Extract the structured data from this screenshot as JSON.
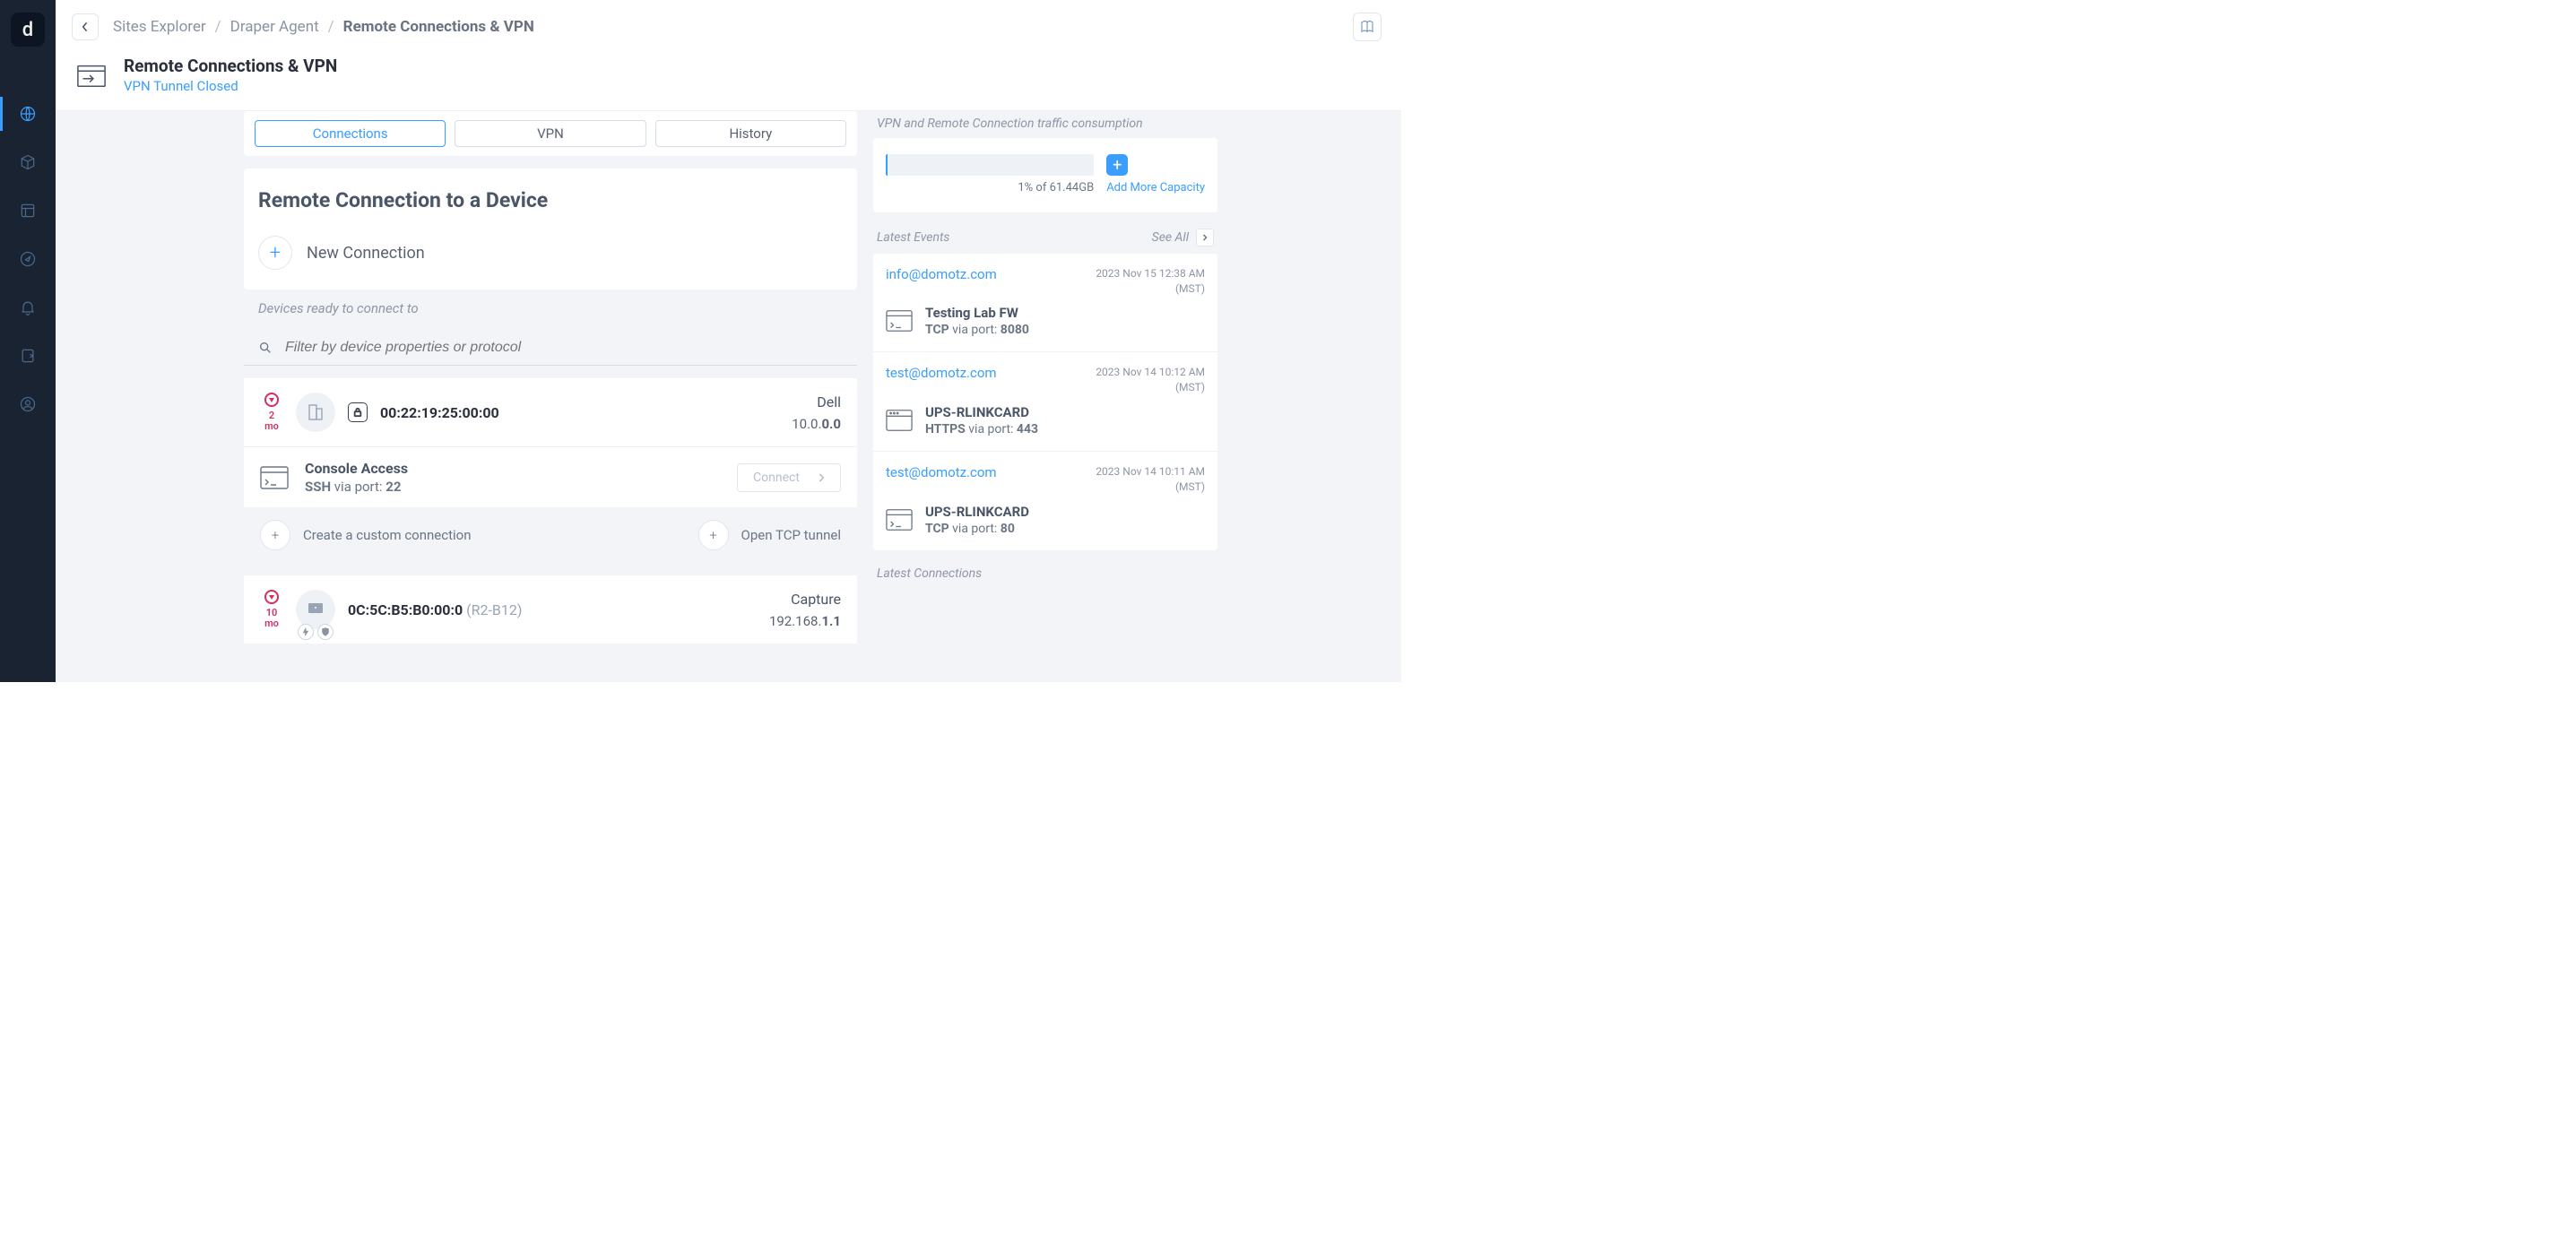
{
  "breadcrumbs": {
    "sites": "Sites Explorer",
    "agent": "Draper Agent",
    "current": "Remote Connections & VPN"
  },
  "page": {
    "title": "Remote Connections & VPN",
    "status": "VPN Tunnel Closed"
  },
  "tabs": {
    "connections": "Connections",
    "vpn": "VPN",
    "history": "History"
  },
  "section": {
    "title": "Remote Connection to a Device",
    "new_connection": "New Connection",
    "devices_ready": "Devices ready to connect to",
    "filter_placeholder": "Filter by device properties or protocol",
    "create_custom": "Create a custom connection",
    "open_tunnel": "Open TCP tunnel",
    "connect_label": "Connect"
  },
  "devices": [
    {
      "age_num": "2",
      "age_unit": "mo",
      "mac": "00:22:19:25:00:00",
      "vendor": "Dell",
      "ip_prefix": "10.0.",
      "ip_bold": "0.0",
      "conn_title": "Console Access",
      "protocol": "SSH",
      "via_port": " via port: ",
      "port": "22"
    },
    {
      "age_num": "10",
      "age_unit": "mo",
      "mac": "0C:5C:B5:B0:00:0",
      "extra": " (R2-B12)",
      "vendor": "Capture",
      "ip_prefix": "192.168.",
      "ip_bold": "1.1"
    }
  ],
  "traffic": {
    "label": "VPN and Remote Connection traffic consumption",
    "caption": "1% of 61.44GB",
    "add_more": "Add More Capacity"
  },
  "events_section": {
    "label": "Latest Events",
    "see_all": "See All"
  },
  "events": [
    {
      "user": "info@domotz.com",
      "timestamp": "2023 Nov 15 12:38 AM",
      "tz": "(MST)",
      "device": "Testing Lab FW",
      "protocol": "TCP",
      "via_port": " via port: ",
      "port": "8080"
    },
    {
      "user": "test@domotz.com",
      "timestamp": "2023 Nov 14 10:12 AM",
      "tz": "(MST)",
      "device": "UPS-RLINKCARD",
      "protocol": "HTTPS",
      "via_port": " via port: ",
      "port": "443"
    },
    {
      "user": "test@domotz.com",
      "timestamp": "2023 Nov 14 10:11 AM",
      "tz": "(MST)",
      "device": "UPS-RLINKCARD",
      "protocol": "TCP",
      "via_port": " via port: ",
      "port": "80"
    }
  ],
  "latest_connections_label": "Latest Connections"
}
